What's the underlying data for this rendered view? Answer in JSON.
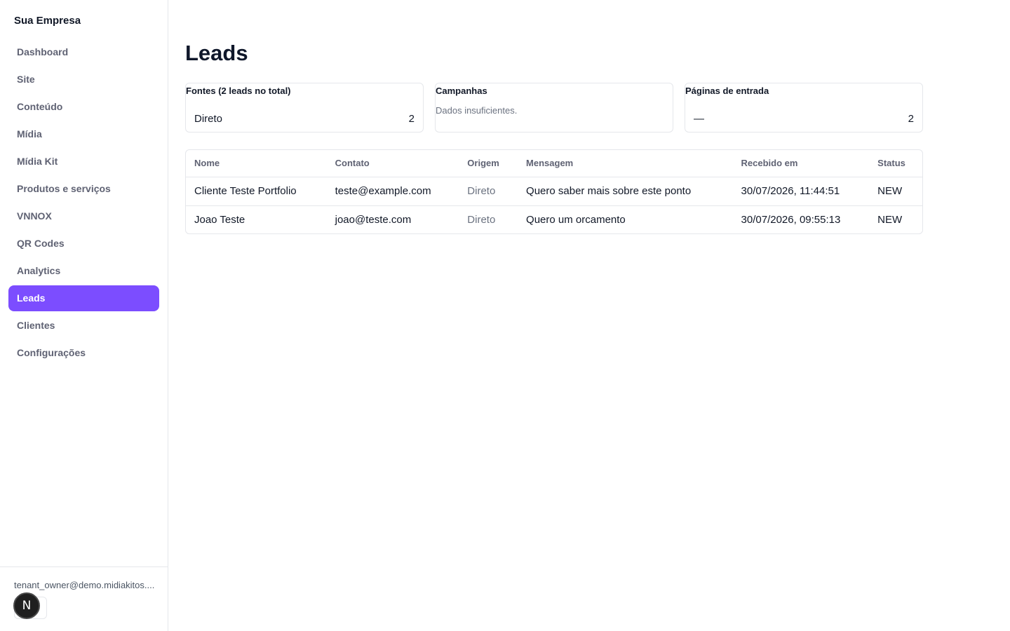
{
  "sidebar": {
    "brand": "Sua Empresa",
    "items": [
      {
        "label": "Dashboard"
      },
      {
        "label": "Site"
      },
      {
        "label": "Conteúdo"
      },
      {
        "label": "Mídia"
      },
      {
        "label": "Mídia Kit"
      },
      {
        "label": "Produtos e serviços"
      },
      {
        "label": "VNNOX"
      },
      {
        "label": "QR Codes"
      },
      {
        "label": "Analytics"
      },
      {
        "label": "Leads"
      },
      {
        "label": "Clientes"
      },
      {
        "label": "Configurações"
      }
    ],
    "active_item": "Leads",
    "user_email": "tenant_owner@demo.midiakitos....",
    "dev_badge": "N"
  },
  "colors": {
    "accent": "#7c4dff",
    "muted_text": "#5f6273",
    "border": "#e5e7eb"
  },
  "main": {
    "title": "Leads",
    "cards": {
      "sources": {
        "title": "Fontes (2 leads no total)",
        "row_label": "Direto",
        "row_value": "2"
      },
      "campaigns": {
        "title": "Campanhas",
        "empty_text": "Dados insuficientes."
      },
      "landing_pages": {
        "title": "Páginas de entrada",
        "row_label": "—",
        "row_value": "2"
      }
    },
    "table": {
      "headers": [
        "Nome",
        "Contato",
        "Origem",
        "Mensagem",
        "Recebido em",
        "Status"
      ],
      "rows": [
        [
          "Cliente Teste Portfolio",
          "teste@example.com",
          "Direto",
          "Quero saber mais sobre este ponto",
          "30/07/2026, 11:44:51",
          "NEW"
        ],
        [
          "Joao Teste",
          "joao@teste.com",
          "Direto",
          "Quero um orcamento",
          "30/07/2026, 09:55:13",
          "NEW"
        ]
      ]
    }
  }
}
